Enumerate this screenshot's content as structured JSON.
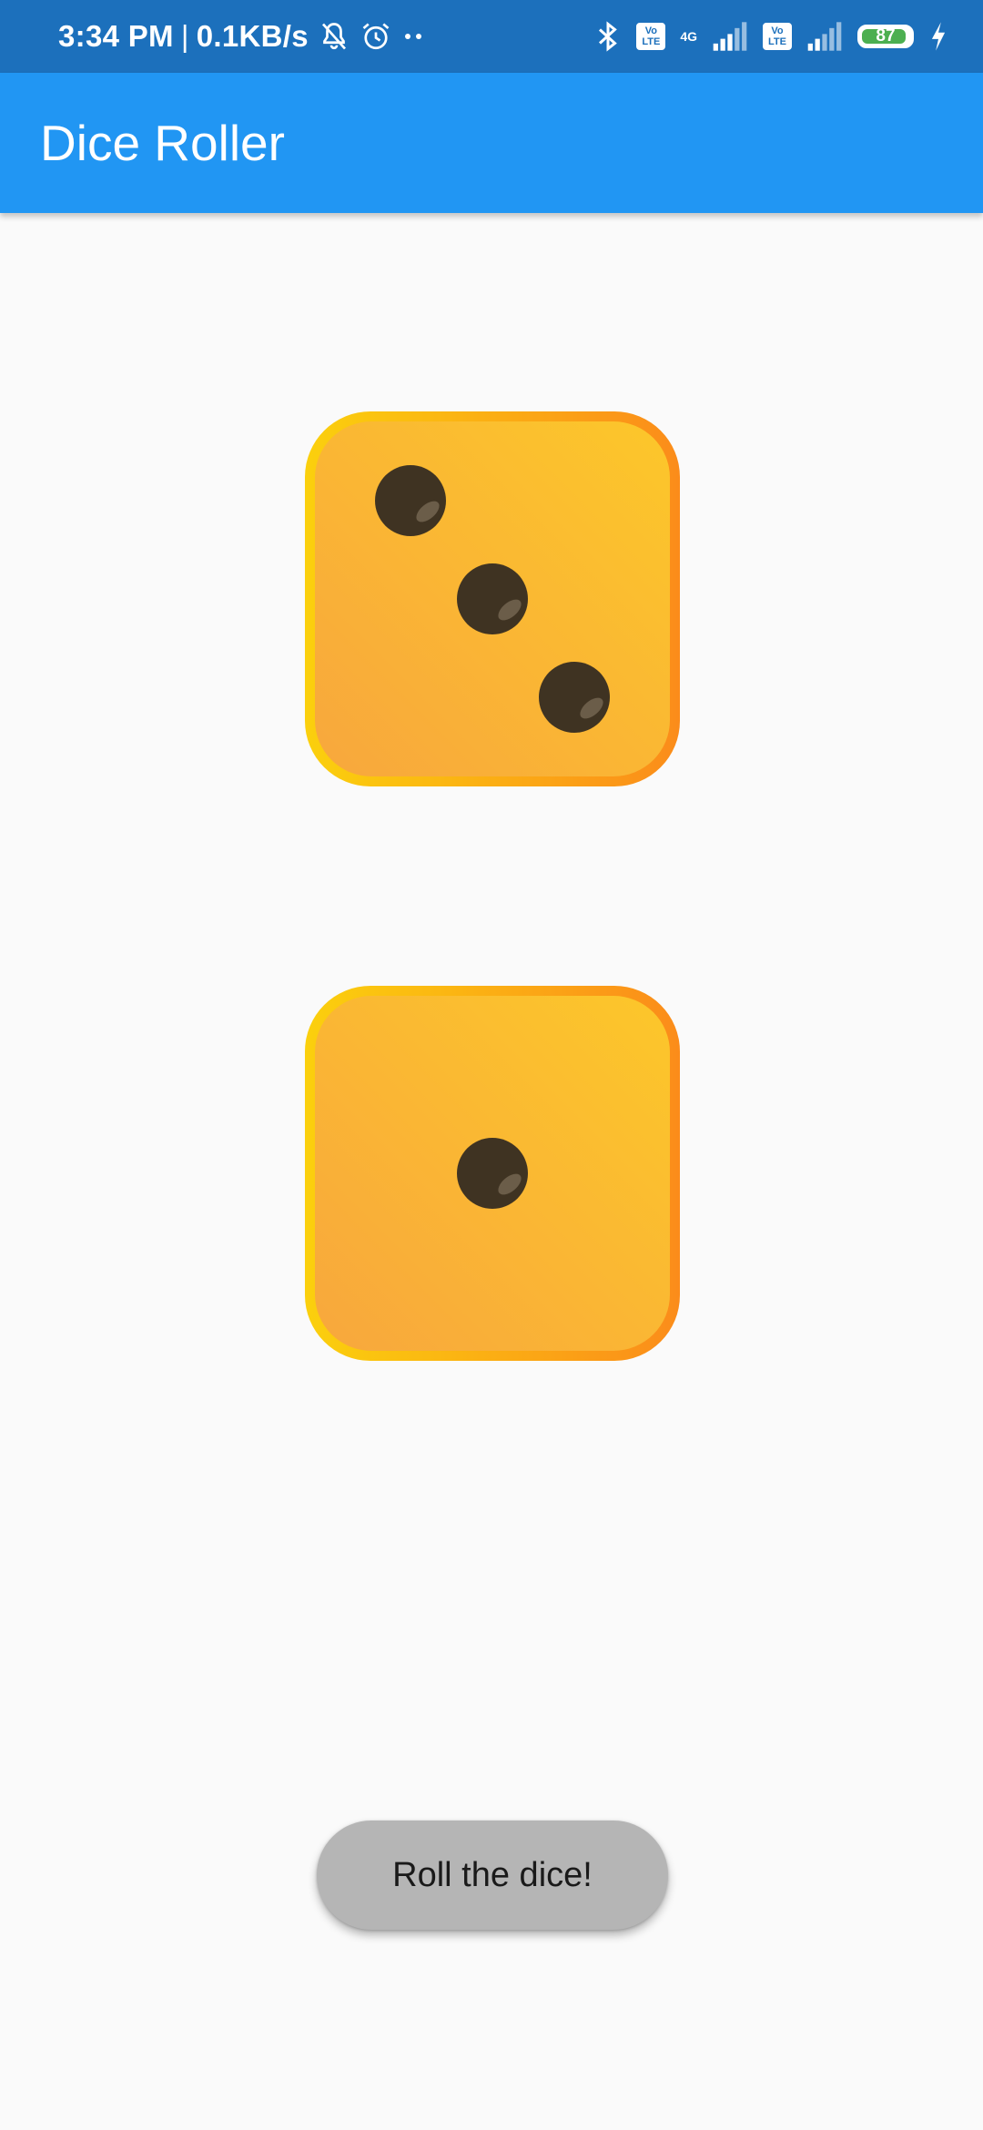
{
  "status_bar": {
    "time": "3:34 PM",
    "separator": "|",
    "speed": "0.1KB/s",
    "volte1": "Vo LTE",
    "network_type": "4G",
    "volte2": "Vo LTE",
    "battery_level": "87",
    "icons": [
      "bell-muted-icon",
      "alarm-icon",
      "more-dots-icon",
      "bluetooth-icon",
      "volte-icon",
      "signal-icon",
      "volte-icon",
      "signal-icon",
      "battery-icon",
      "charging-icon"
    ]
  },
  "app_bar": {
    "title": "Dice Roller"
  },
  "dice": {
    "die1_value": 3,
    "die2_value": 1,
    "colors": {
      "face_light": "#fcc72a",
      "face_dark": "#f8a73d",
      "border_light": "#fbd00d",
      "border_dark": "#fb8c1a",
      "pip": "#3f3322"
    }
  },
  "roll_button": {
    "label": "Roll the dice!"
  },
  "colors": {
    "status_bar": "#1c70bc",
    "app_bar": "#2196f3",
    "background": "#fafafa",
    "button": "#b5b5b5"
  }
}
